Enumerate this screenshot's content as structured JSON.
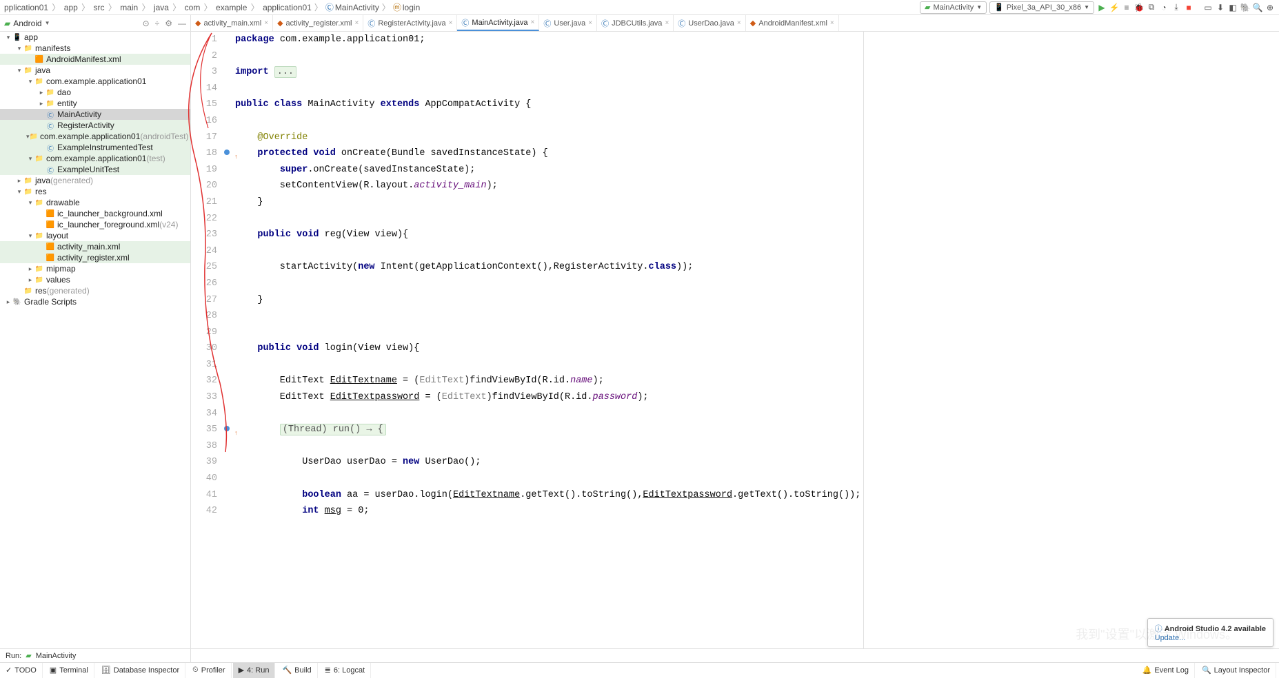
{
  "breadcrumb": [
    "pplication01",
    "app",
    "src",
    "main",
    "java",
    "com",
    "example",
    "application01"
  ],
  "breadcrumb_class": "MainActivity",
  "breadcrumb_method": "login",
  "run_config": "MainActivity",
  "device": "Pixel_3a_API_30_x86",
  "panel_mode": "Android",
  "tree": [
    {
      "depth": 0,
      "arrow": "▾",
      "icon": "📱",
      "label": "app",
      "style": "bold"
    },
    {
      "depth": 1,
      "arrow": "▾",
      "icon": "📁",
      "label": "manifests"
    },
    {
      "depth": 2,
      "arrow": "",
      "icon": "🟧",
      "label": "AndroidManifest.xml",
      "hl": true
    },
    {
      "depth": 1,
      "arrow": "▾",
      "icon": "📁",
      "label": "java"
    },
    {
      "depth": 2,
      "arrow": "▾",
      "icon": "📁",
      "label": "com.example.application01"
    },
    {
      "depth": 3,
      "arrow": "▸",
      "icon": "📁",
      "label": "dao"
    },
    {
      "depth": 3,
      "arrow": "▸",
      "icon": "📁",
      "label": "entity"
    },
    {
      "depth": 3,
      "arrow": "",
      "icon": "Ⓒ",
      "label": "MainActivity",
      "selected": true
    },
    {
      "depth": 3,
      "arrow": "",
      "icon": "Ⓒ",
      "label": "RegisterActivity",
      "hl": true
    },
    {
      "depth": 2,
      "arrow": "▾",
      "icon": "📁",
      "label": "com.example.application01",
      "suffix": "(androidTest)",
      "hl": true
    },
    {
      "depth": 3,
      "arrow": "",
      "icon": "Ⓒ",
      "label": "ExampleInstrumentedTest",
      "hl": true
    },
    {
      "depth": 2,
      "arrow": "▾",
      "icon": "📁",
      "label": "com.example.application01",
      "suffix": "(test)",
      "hl": true
    },
    {
      "depth": 3,
      "arrow": "",
      "icon": "Ⓒ",
      "label": "ExampleUnitTest",
      "hl": true
    },
    {
      "depth": 1,
      "arrow": "▸",
      "icon": "📁",
      "label": "java",
      "suffix": "(generated)"
    },
    {
      "depth": 1,
      "arrow": "▾",
      "icon": "📁",
      "label": "res"
    },
    {
      "depth": 2,
      "arrow": "▾",
      "icon": "📁",
      "label": "drawable"
    },
    {
      "depth": 3,
      "arrow": "",
      "icon": "🟧",
      "label": "ic_launcher_background.xml"
    },
    {
      "depth": 3,
      "arrow": "",
      "icon": "🟧",
      "label": "ic_launcher_foreground.xml",
      "suffix": "(v24)"
    },
    {
      "depth": 2,
      "arrow": "▾",
      "icon": "📁",
      "label": "layout"
    },
    {
      "depth": 3,
      "arrow": "",
      "icon": "🟧",
      "label": "activity_main.xml",
      "hl": true
    },
    {
      "depth": 3,
      "arrow": "",
      "icon": "🟧",
      "label": "activity_register.xml",
      "hl": true
    },
    {
      "depth": 2,
      "arrow": "▸",
      "icon": "📁",
      "label": "mipmap"
    },
    {
      "depth": 2,
      "arrow": "▸",
      "icon": "📁",
      "label": "values"
    },
    {
      "depth": 1,
      "arrow": "",
      "icon": "📁",
      "label": "res",
      "suffix": "(generated)"
    },
    {
      "depth": 0,
      "arrow": "▸",
      "icon": "🐘",
      "label": "Gradle Scripts"
    }
  ],
  "tabs": [
    {
      "label": "activity_main.xml",
      "type": "xml"
    },
    {
      "label": "activity_register.xml",
      "type": "xml"
    },
    {
      "label": "RegisterActivity.java",
      "type": "java"
    },
    {
      "label": "MainActivity.java",
      "type": "java",
      "active": true
    },
    {
      "label": "User.java",
      "type": "java"
    },
    {
      "label": "JDBCUtils.java",
      "type": "java"
    },
    {
      "label": "UserDao.java",
      "type": "java"
    },
    {
      "label": "AndroidManifest.xml",
      "type": "xml"
    }
  ],
  "line_numbers": [
    "1",
    "2",
    "3",
    "14",
    "15",
    "16",
    "17",
    "18",
    "19",
    "20",
    "21",
    "22",
    "23",
    "24",
    "25",
    "26",
    "27",
    "28",
    "29",
    "30",
    "31",
    "32",
    "33",
    "34",
    "35",
    "38",
    "39",
    "40",
    "41",
    "42"
  ],
  "gutter_marks": {
    "18": "bp",
    "35": "bp",
    "1": "arrow"
  },
  "run_tab": {
    "label": "Run:",
    "config": "MainActivity"
  },
  "status_tools": [
    {
      "label": "TODO",
      "icon": "✓"
    },
    {
      "label": "Terminal",
      "icon": "▣"
    },
    {
      "label": "Database Inspector",
      "icon": "🗄"
    },
    {
      "label": "Profiler",
      "icon": "⏲"
    },
    {
      "label": "4: Run",
      "icon": "▶",
      "active": true
    },
    {
      "label": "Build",
      "icon": "🔨"
    },
    {
      "label": "6: Logcat",
      "icon": "≣"
    }
  ],
  "status_right": [
    {
      "label": "Event Log",
      "icon": "🔔",
      "warn": true
    },
    {
      "label": "Layout Inspector",
      "icon": "🔍"
    }
  ],
  "notification": {
    "title": "Android Studio 4.2 available",
    "action": "Update..."
  },
  "watermark": "我到\"设置\"以激活 Windows。"
}
